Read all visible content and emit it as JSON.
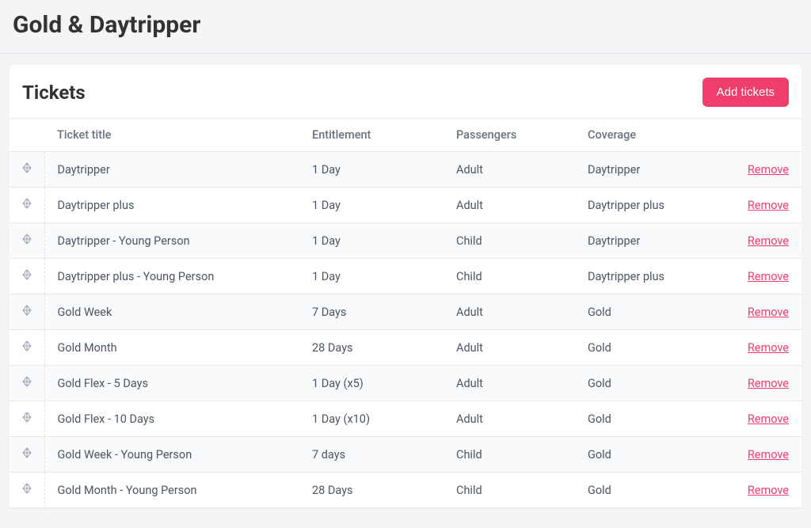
{
  "pageTitle": "Gold & Daytripper",
  "card": {
    "title": "Tickets",
    "addButton": "Add tickets"
  },
  "columns": {
    "title": "Ticket title",
    "entitlement": "Entitlement",
    "passengers": "Passengers",
    "coverage": "Coverage"
  },
  "removeLabel": "Remove",
  "rows": [
    {
      "title": "Daytripper",
      "entitlement": "1 Day",
      "passengers": "Adult",
      "coverage": "Daytripper"
    },
    {
      "title": "Daytripper plus",
      "entitlement": "1 Day",
      "passengers": "Adult",
      "coverage": "Daytripper plus"
    },
    {
      "title": "Daytripper - Young Person",
      "entitlement": "1 Day",
      "passengers": "Child",
      "coverage": "Daytripper"
    },
    {
      "title": "Daytripper plus - Young Person",
      "entitlement": "1 Day",
      "passengers": "Child",
      "coverage": "Daytripper plus"
    },
    {
      "title": "Gold Week",
      "entitlement": "7 Days",
      "passengers": "Adult",
      "coverage": "Gold"
    },
    {
      "title": "Gold Month",
      "entitlement": "28 Days",
      "passengers": "Adult",
      "coverage": "Gold"
    },
    {
      "title": "Gold Flex - 5 Days",
      "entitlement": "1 Day (x5)",
      "passengers": "Adult",
      "coverage": "Gold"
    },
    {
      "title": "Gold Flex - 10 Days",
      "entitlement": "1 Day (x10)",
      "passengers": "Adult",
      "coverage": "Gold"
    },
    {
      "title": "Gold Week - Young Person",
      "entitlement": "7 days",
      "passengers": "Child",
      "coverage": "Gold"
    },
    {
      "title": "Gold Month - Young Person",
      "entitlement": "28 Days",
      "passengers": "Child",
      "coverage": "Gold"
    }
  ]
}
